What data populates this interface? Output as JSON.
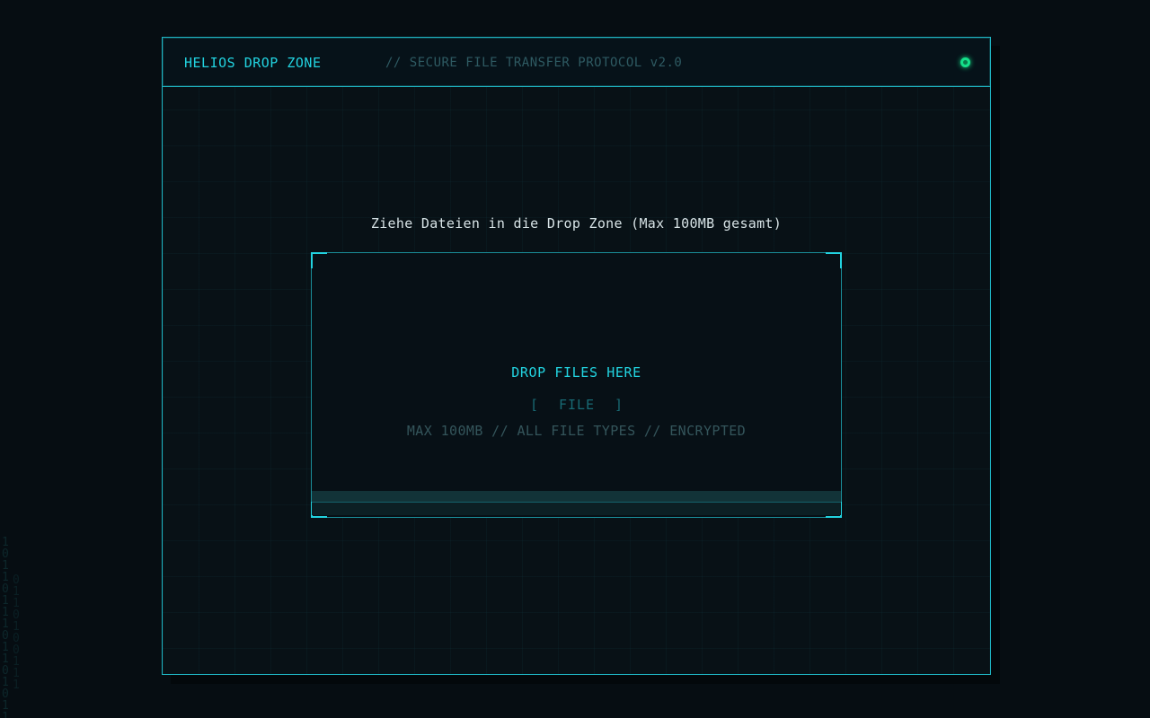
{
  "window": {
    "app_title": "HELIOS DROP ZONE",
    "protocol_label": "// SECURE FILE TRANSFER PROTOCOL v2.0"
  },
  "instruction": "Ziehe Dateien in die Drop Zone (Max 100MB gesamt)",
  "dropzone": {
    "label": "DROP FILES HERE",
    "file_button": {
      "bracket_open": "[",
      "label": "FILE",
      "bracket_close": "]"
    },
    "meta": "MAX 100MB // ALL FILE TYPES // ENCRYPTED",
    "progress_percent": 0
  },
  "background_binary": {
    "col1": "1\n0\n1\n1\n0\n1\n1\n1\n0\n1\n1\n0\n1\n0\n1\n1",
    "col2": "0\n1\n1\n0\n1\n0\n0\n1\n1\n1"
  },
  "colors": {
    "accent": "#22d3e0",
    "status_online": "#14e08a",
    "background": "#060d12"
  },
  "icons": {
    "status": "status-indicator-icon"
  }
}
